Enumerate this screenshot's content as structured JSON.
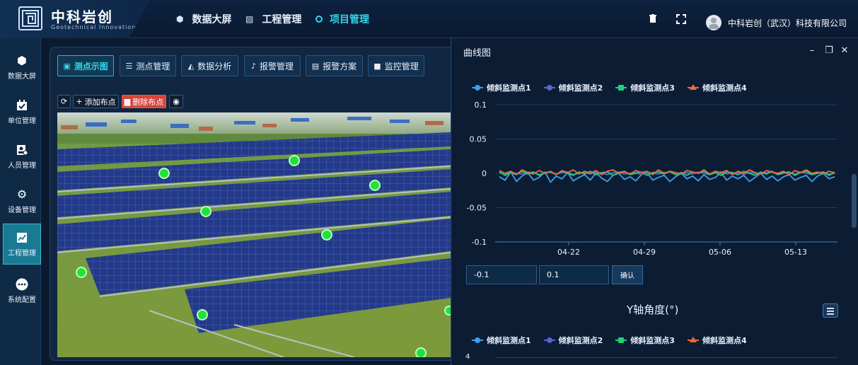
{
  "header": {
    "brand_cn": "中科岩创",
    "brand_en": "Geotechnical Innovation",
    "nav": [
      {
        "label": "数据大屏",
        "icon": "cube-icon"
      },
      {
        "label": "工程管理",
        "icon": "chart-icon"
      },
      {
        "label": "项目管理",
        "icon": "ring-icon",
        "active": true
      }
    ],
    "company": "中科岩创（武汉）科技有限公司"
  },
  "sidebar": {
    "items": [
      {
        "label": "数据大屏",
        "icon": "cube-icon"
      },
      {
        "label": "单位管理",
        "icon": "calendar-check-icon"
      },
      {
        "label": "人员管理",
        "icon": "id-card-icon"
      },
      {
        "label": "设备管理",
        "icon": "gear-icon"
      },
      {
        "label": "工程管理",
        "icon": "line-chart-icon",
        "active": true
      },
      {
        "label": "系统配置",
        "icon": "more-icon"
      }
    ]
  },
  "tabs": [
    {
      "label": "测点示图",
      "icon": "image-icon",
      "active": true
    },
    {
      "label": "测点管理",
      "icon": "list-icon"
    },
    {
      "label": "数据分析",
      "icon": "area-chart-icon"
    },
    {
      "label": "报警管理",
      "icon": "bell-icon"
    },
    {
      "label": "报警方案",
      "icon": "book-icon"
    },
    {
      "label": "监控管理",
      "icon": "video-icon"
    }
  ],
  "toolbar": {
    "add_label": "添加布点",
    "delete_label": "删除布点"
  },
  "curve_window": {
    "title": "曲线图",
    "legend": [
      "倾斜监测点1",
      "倾斜监测点2",
      "倾斜监测点3",
      "倾斜监测点4"
    ],
    "min_value": "-0.1",
    "max_value": "0.1",
    "confirm_label": "确认",
    "second_chart_title": "Y轴角度(°)",
    "second_chart_first_tick": "4"
  },
  "colors": {
    "accent": "#31d6e8",
    "series": [
      "#3aa0ef",
      "#5b62d6",
      "#22d07a",
      "#f0693c"
    ],
    "danger": "#d7443a"
  },
  "chart_data": {
    "type": "line",
    "title": "",
    "xlabel": "",
    "ylabel": "",
    "ylim": [
      -0.1,
      0.1
    ],
    "yticks": [
      "0.1",
      "0.05",
      "0",
      "-0.05",
      "-0.1"
    ],
    "xticks": [
      "04-22",
      "04-29",
      "05-06",
      "05-13"
    ],
    "series": [
      {
        "name": "倾斜监测点1",
        "values": [
          -0.005,
          -0.01,
          0.002,
          -0.012,
          -0.004,
          0.001,
          -0.01,
          -0.006,
          0.002,
          -0.013,
          -0.004,
          -0.008,
          0.001,
          -0.011,
          -0.006,
          -0.002,
          -0.01,
          0.001,
          -0.007,
          -0.012,
          -0.003,
          0.0,
          -0.009,
          -0.005,
          -0.011,
          -0.002,
          0.001,
          -0.01,
          -0.006,
          -0.003,
          -0.012,
          -0.005,
          0.0,
          -0.008,
          -0.004,
          -0.011,
          -0.002,
          -0.009,
          -0.006,
          0.001,
          -0.01,
          -0.004,
          -0.008,
          -0.003,
          -0.012,
          -0.006,
          0.0,
          -0.009,
          -0.004,
          -0.011,
          -0.005,
          -0.002,
          -0.01,
          -0.006,
          -0.003,
          -0.012,
          -0.004,
          0.0,
          -0.008,
          -0.005
        ]
      },
      {
        "name": "倾斜监测点2",
        "values": [
          0.001,
          -0.002,
          0.002,
          0.0,
          -0.001,
          0.002,
          0.001,
          -0.002,
          0.0,
          0.002,
          -0.001,
          0.001,
          0.002,
          -0.002,
          0.0,
          0.001,
          -0.001,
          0.002,
          0.0,
          -0.002,
          0.001,
          0.002,
          -0.001,
          0.0,
          0.001,
          -0.002,
          0.002,
          0.0,
          -0.001,
          0.001,
          0.002,
          -0.002,
          0.0,
          0.001,
          -0.001,
          0.002,
          0.0,
          -0.002,
          0.001,
          0.002,
          -0.001,
          0.0,
          0.001,
          -0.002,
          0.002,
          0.0,
          -0.001,
          0.001,
          0.002,
          -0.002,
          0.0,
          0.001,
          -0.001,
          0.002,
          0.0,
          -0.002,
          0.001,
          0.002,
          -0.001,
          0.0
        ]
      },
      {
        "name": "倾斜监测点3",
        "values": [
          0.002,
          -0.003,
          0.001,
          -0.002,
          0.003,
          -0.001,
          0.002,
          -0.003,
          0.001,
          0.002,
          -0.002,
          0.003,
          0.0,
          -0.003,
          0.002,
          -0.001,
          0.003,
          -0.002,
          0.001,
          0.002,
          -0.003,
          0.001,
          0.003,
          -0.002,
          0.0,
          0.002,
          -0.003,
          0.001,
          0.002,
          -0.001,
          0.003,
          -0.002,
          0.001,
          -0.003,
          0.002,
          0.0,
          0.003,
          -0.002,
          0.001,
          -0.003,
          0.002,
          0.001,
          -0.002,
          0.003,
          0.0,
          -0.003,
          0.002,
          -0.001,
          0.003,
          -0.002,
          0.001,
          0.002,
          -0.003,
          0.001,
          0.003,
          -0.002,
          0.0,
          0.002,
          -0.003,
          0.001
        ]
      },
      {
        "name": "倾斜监测点4",
        "values": [
          0.004,
          0.0,
          0.003,
          -0.002,
          0.005,
          0.001,
          -0.001,
          0.004,
          0.0,
          0.003,
          -0.002,
          0.004,
          0.001,
          0.005,
          -0.001,
          0.003,
          0.0,
          0.004,
          -0.002,
          0.003,
          0.005,
          0.0,
          0.002,
          -0.001,
          0.004,
          0.001,
          0.003,
          -0.002,
          0.005,
          0.0,
          0.003,
          0.001,
          -0.001,
          0.004,
          0.002,
          0.0,
          0.005,
          -0.001,
          0.003,
          0.001,
          0.004,
          -0.002,
          0.003,
          0.0,
          0.005,
          0.001,
          -0.001,
          0.004,
          0.002,
          0.0,
          0.003,
          -0.002,
          0.004,
          0.001,
          0.005,
          0.0,
          0.002,
          -0.001,
          0.003,
          0.001
        ]
      }
    ]
  }
}
